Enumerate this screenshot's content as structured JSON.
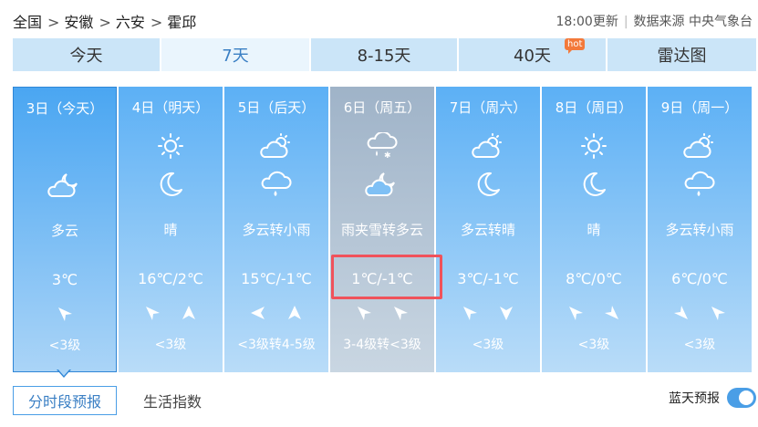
{
  "breadcrumb": [
    {
      "label": "全国"
    },
    {
      "label": "安徽"
    },
    {
      "label": "六安"
    },
    {
      "label": "霍邱"
    }
  ],
  "breadcrumb_sep": ">",
  "header": {
    "updated": "18:00更新",
    "source": "数据来源 中央气象台"
  },
  "tabs": [
    {
      "label": "今天"
    },
    {
      "label": "7天",
      "active": true
    },
    {
      "label": "8-15天"
    },
    {
      "label": "40天",
      "badge": "hot"
    },
    {
      "label": "雷达图"
    }
  ],
  "days": [
    {
      "date": "3日（今天）",
      "icon1": "",
      "icon2": "partly-cloudy-night-icon",
      "weather": "多云",
      "temp": "3℃",
      "wind1": "arrow-upright-icon",
      "wind2": "",
      "level": "<3级",
      "today": true
    },
    {
      "date": "4日（明天）",
      "icon1": "sun-icon",
      "icon2": "moon-icon",
      "weather": "晴",
      "temp": "16℃/2℃",
      "wind1": "arrow-upright-icon",
      "wind2": "arrow-up-icon",
      "level": "<3级"
    },
    {
      "date": "5日（后天）",
      "icon1": "partly-cloudy-icon",
      "icon2": "light-rain-icon",
      "weather": "多云转小雨",
      "temp": "15℃/-1℃",
      "wind1": "arrow-left-icon",
      "wind2": "arrow-up-icon",
      "level": "<3级转4-5级"
    },
    {
      "date": "6日（周五）",
      "icon1": "sleet-icon",
      "icon2": "partly-cloudy-night-icon",
      "weather": "雨夹雪转多云",
      "temp": "1℃/-1℃",
      "wind1": "arrow-upright-icon",
      "wind2": "arrow-upright-icon",
      "level": "3-4级转<3级",
      "gray": true
    },
    {
      "date": "7日（周六）",
      "icon1": "partly-cloudy-icon",
      "icon2": "moon-icon",
      "weather": "多云转晴",
      "temp": "3℃/-1℃",
      "wind1": "arrow-upright-icon",
      "wind2": "arrow-down-icon",
      "level": "<3级"
    },
    {
      "date": "8日（周日）",
      "icon1": "sun-icon",
      "icon2": "moon-icon",
      "weather": "晴",
      "temp": "8℃/0℃",
      "wind1": "arrow-upright-icon",
      "wind2": "arrow-upleft-icon",
      "level": "<3级"
    },
    {
      "date": "9日（周一）",
      "icon1": "partly-cloudy-icon",
      "icon2": "light-rain-icon",
      "weather": "多云转小雨",
      "temp": "6℃/0℃",
      "wind1": "arrow-upleft-icon",
      "wind2": "arrow-upright-icon",
      "level": "<3级"
    }
  ],
  "bottom_tabs": {
    "active": "分时段预报",
    "inactive": "生活指数"
  },
  "night_toggle": {
    "label": "蓝天预报"
  }
}
